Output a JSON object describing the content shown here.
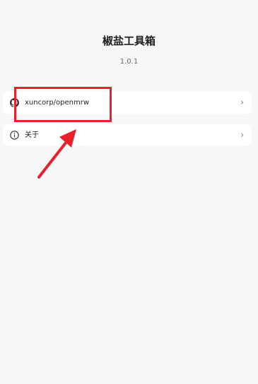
{
  "app": {
    "title": "椒盐工具箱",
    "version": "1.0.1"
  },
  "list": {
    "items": [
      {
        "label": "xuncorp/openmrw",
        "icon": "github-icon",
        "chevron": "›"
      },
      {
        "label": "关于",
        "icon": "info-icon",
        "chevron": "›"
      }
    ]
  },
  "annotation": {
    "color": "#e8202c",
    "shapes": [
      "highlight-box",
      "pointer-arrow"
    ]
  },
  "colors": {
    "background": "#f6f7f9",
    "card": "#ffffff",
    "accent": "#e8202c"
  }
}
